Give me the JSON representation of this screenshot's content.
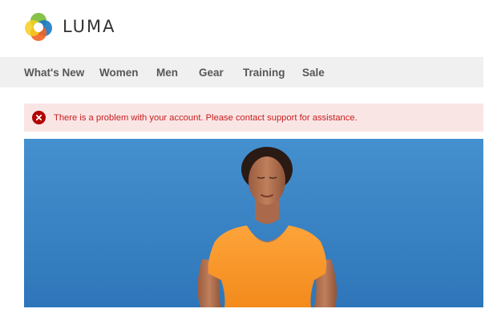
{
  "brand": {
    "name": "LUMA",
    "logo_icon": "luma-logo-icon",
    "colors": {
      "orange": "#f26322",
      "blue": "#1979c3",
      "green": "#7fbf3f",
      "yellow": "#f5d020"
    }
  },
  "nav": {
    "items": [
      {
        "label": "What's New"
      },
      {
        "label": "Women"
      },
      {
        "label": "Men"
      },
      {
        "label": "Gear"
      },
      {
        "label": "Training"
      },
      {
        "label": "Sale"
      }
    ]
  },
  "message": {
    "type": "error",
    "icon": "error-x-icon",
    "text": "There is a problem with your account. Please contact support for assistance.",
    "colors": {
      "background": "#fae5e5",
      "text": "#c81e1e",
      "icon": "#b30000"
    }
  },
  "hero": {
    "image": "woman-meditating-orange-top-blue-sky",
    "colors": {
      "sky": "#3b86c6",
      "top": "#fb9a2a"
    }
  }
}
